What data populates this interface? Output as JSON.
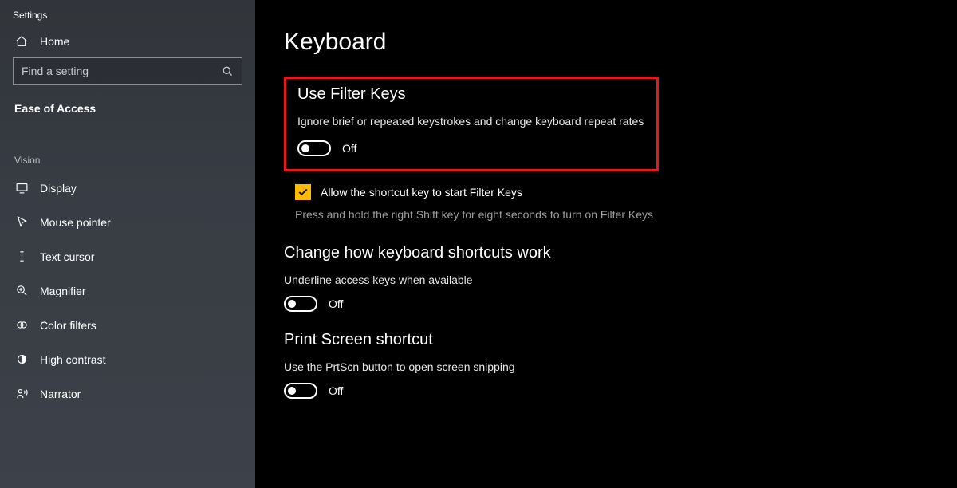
{
  "app_title": "Settings",
  "home_label": "Home",
  "search": {
    "placeholder": "Find a setting"
  },
  "category": "Ease of Access",
  "vision_label": "Vision",
  "nav": [
    {
      "label": "Display"
    },
    {
      "label": "Mouse pointer"
    },
    {
      "label": "Text cursor"
    },
    {
      "label": "Magnifier"
    },
    {
      "label": "Color filters"
    },
    {
      "label": "High contrast"
    },
    {
      "label": "Narrator"
    }
  ],
  "page": {
    "title": "Keyboard",
    "filter": {
      "heading": "Use Filter Keys",
      "desc": "Ignore brief or repeated keystrokes and change keyboard repeat rates",
      "state": "Off",
      "checkbox_label": "Allow the shortcut key to start Filter Keys",
      "hint": "Press and hold the right Shift key for eight seconds to turn on Filter Keys"
    },
    "shortcuts": {
      "heading": "Change how keyboard shortcuts work",
      "desc": "Underline access keys when available",
      "state": "Off"
    },
    "prtscn": {
      "heading": "Print Screen shortcut",
      "desc": "Use the PrtScn button to open screen snipping",
      "state": "Off"
    }
  }
}
